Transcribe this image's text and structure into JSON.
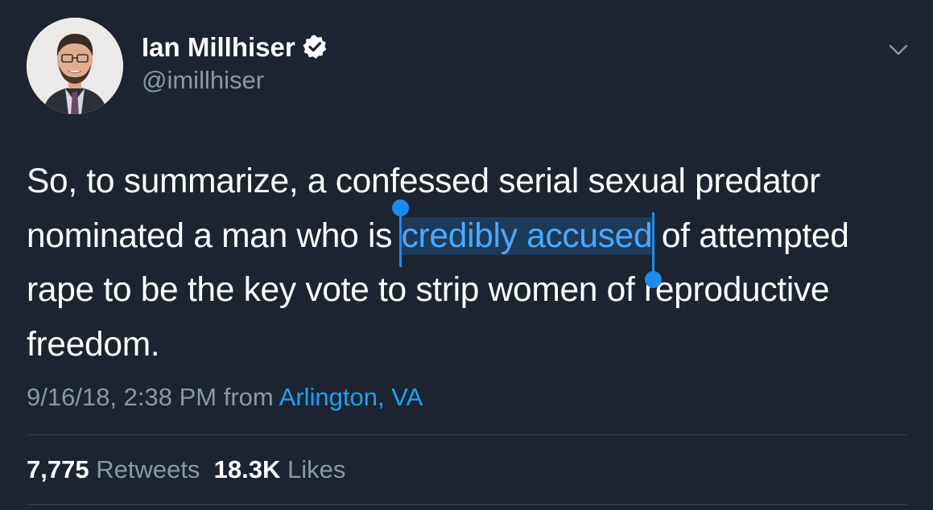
{
  "tweet": {
    "author": {
      "name": "Ian Millhiser",
      "handle": "@imillhiser",
      "verified": true,
      "avatar_icon": "profile-photo-man-glasses-suit"
    },
    "text": {
      "line1": "So, to summarize, a confessed serial sexual predator",
      "line2_before": "nominated a man who is ",
      "line2_selected": "credibly accused",
      "line2_after": " of attempted",
      "line3": "rape to be the key vote to strip women of reproductive",
      "line4": "freedom."
    },
    "meta": {
      "timestamp": "9/16/18, 2:38 PM",
      "from_label": "from",
      "location": "Arlington, VA"
    },
    "stats": {
      "retweets_count": "7,775",
      "retweets_label": "Retweets",
      "likes_count": "18.3K",
      "likes_label": "Likes"
    }
  },
  "colors": {
    "background": "#1b2430",
    "primary_text": "#ffffff",
    "secondary_text": "#8899a6",
    "link": "#1da1f2",
    "selection_bg": "#1d3a59",
    "selection_text": "#4aa8ff",
    "selection_handle": "#1d8bf0",
    "divider": "#38444d"
  }
}
